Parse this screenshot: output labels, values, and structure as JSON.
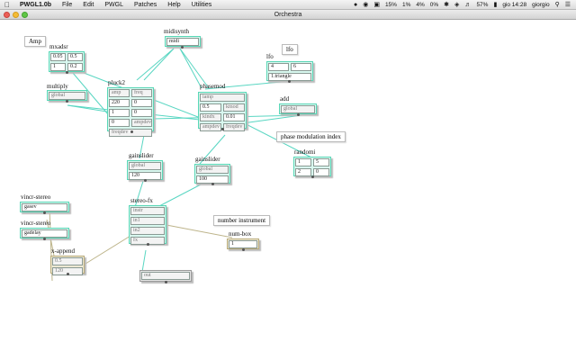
{
  "menubar": {
    "app_name": "PWGL1.0b",
    "items": [
      "File",
      "Edit",
      "PWGL",
      "Patches",
      "Help",
      "Utilities"
    ],
    "status": {
      "battery_indicator_1": "15%",
      "indicator_2": "1%",
      "indicator_3": "4%",
      "indicator_4": "0%",
      "battery": "57%",
      "clock": "gio 14:28",
      "user": "giorgio"
    }
  },
  "window": {
    "title": "Orchestra"
  },
  "notes": {
    "amp": "Amp",
    "lfo": "lfo",
    "phase_modulation_index": "phase modulation index",
    "number_instrument": "number instrument"
  },
  "boxes": {
    "mxadsr": {
      "title": "mxadsr",
      "values": [
        "0.05",
        "0.5",
        "1",
        "0.2"
      ]
    },
    "midisynth": {
      "title": "midisynth",
      "value": "midi"
    },
    "lfo": {
      "title": "lfo",
      "values": [
        "4",
        "6"
      ],
      "mode": "1.triangle"
    },
    "multiply": {
      "title": "multiply",
      "value": "global"
    },
    "pluck2": {
      "title": "pluck2",
      "rows": [
        [
          "amp",
          "freq"
        ],
        [
          "220",
          "0"
        ],
        [
          "1",
          "0"
        ],
        [
          "0",
          "ampdev"
        ],
        [
          "freqdev",
          ""
        ]
      ]
    },
    "phasemod": {
      "title": "phasemod",
      "rows": [
        [
          "iamp",
          ""
        ],
        [
          "0.5",
          "kmod"
        ],
        [
          "kindx",
          "0.01"
        ],
        [
          "ampdev",
          "freqdev"
        ]
      ]
    },
    "add": {
      "title": "add",
      "value": "global"
    },
    "gainslider1": {
      "title": "gainslider",
      "values": [
        "global",
        "120"
      ]
    },
    "gainslider2": {
      "title": "gainslider",
      "values": [
        "global",
        "100"
      ]
    },
    "randomi": {
      "title": "randomi",
      "values": [
        "1",
        "5",
        "2",
        "0"
      ]
    },
    "vincr_stereo1": {
      "title": "vincr-stereo",
      "value": "gasev"
    },
    "vincr_stereo2": {
      "title": "vincr-stereo",
      "value": "gadelay"
    },
    "stereo_fx": {
      "title": "stereo-fx",
      "rows": [
        "instr",
        "in1",
        "in2",
        "fx"
      ]
    },
    "x_append": {
      "title": "x-append",
      "values": [
        "0.5",
        "120"
      ]
    },
    "num_box": {
      "title": "num-box",
      "value": "1"
    },
    "out": {
      "value": "out"
    }
  },
  "colors": {
    "box_fill": "#d8f8ef",
    "box_border": "#59d6b6",
    "wire_main": "#59d6c2",
    "wire_alt": "#bdb48a"
  }
}
